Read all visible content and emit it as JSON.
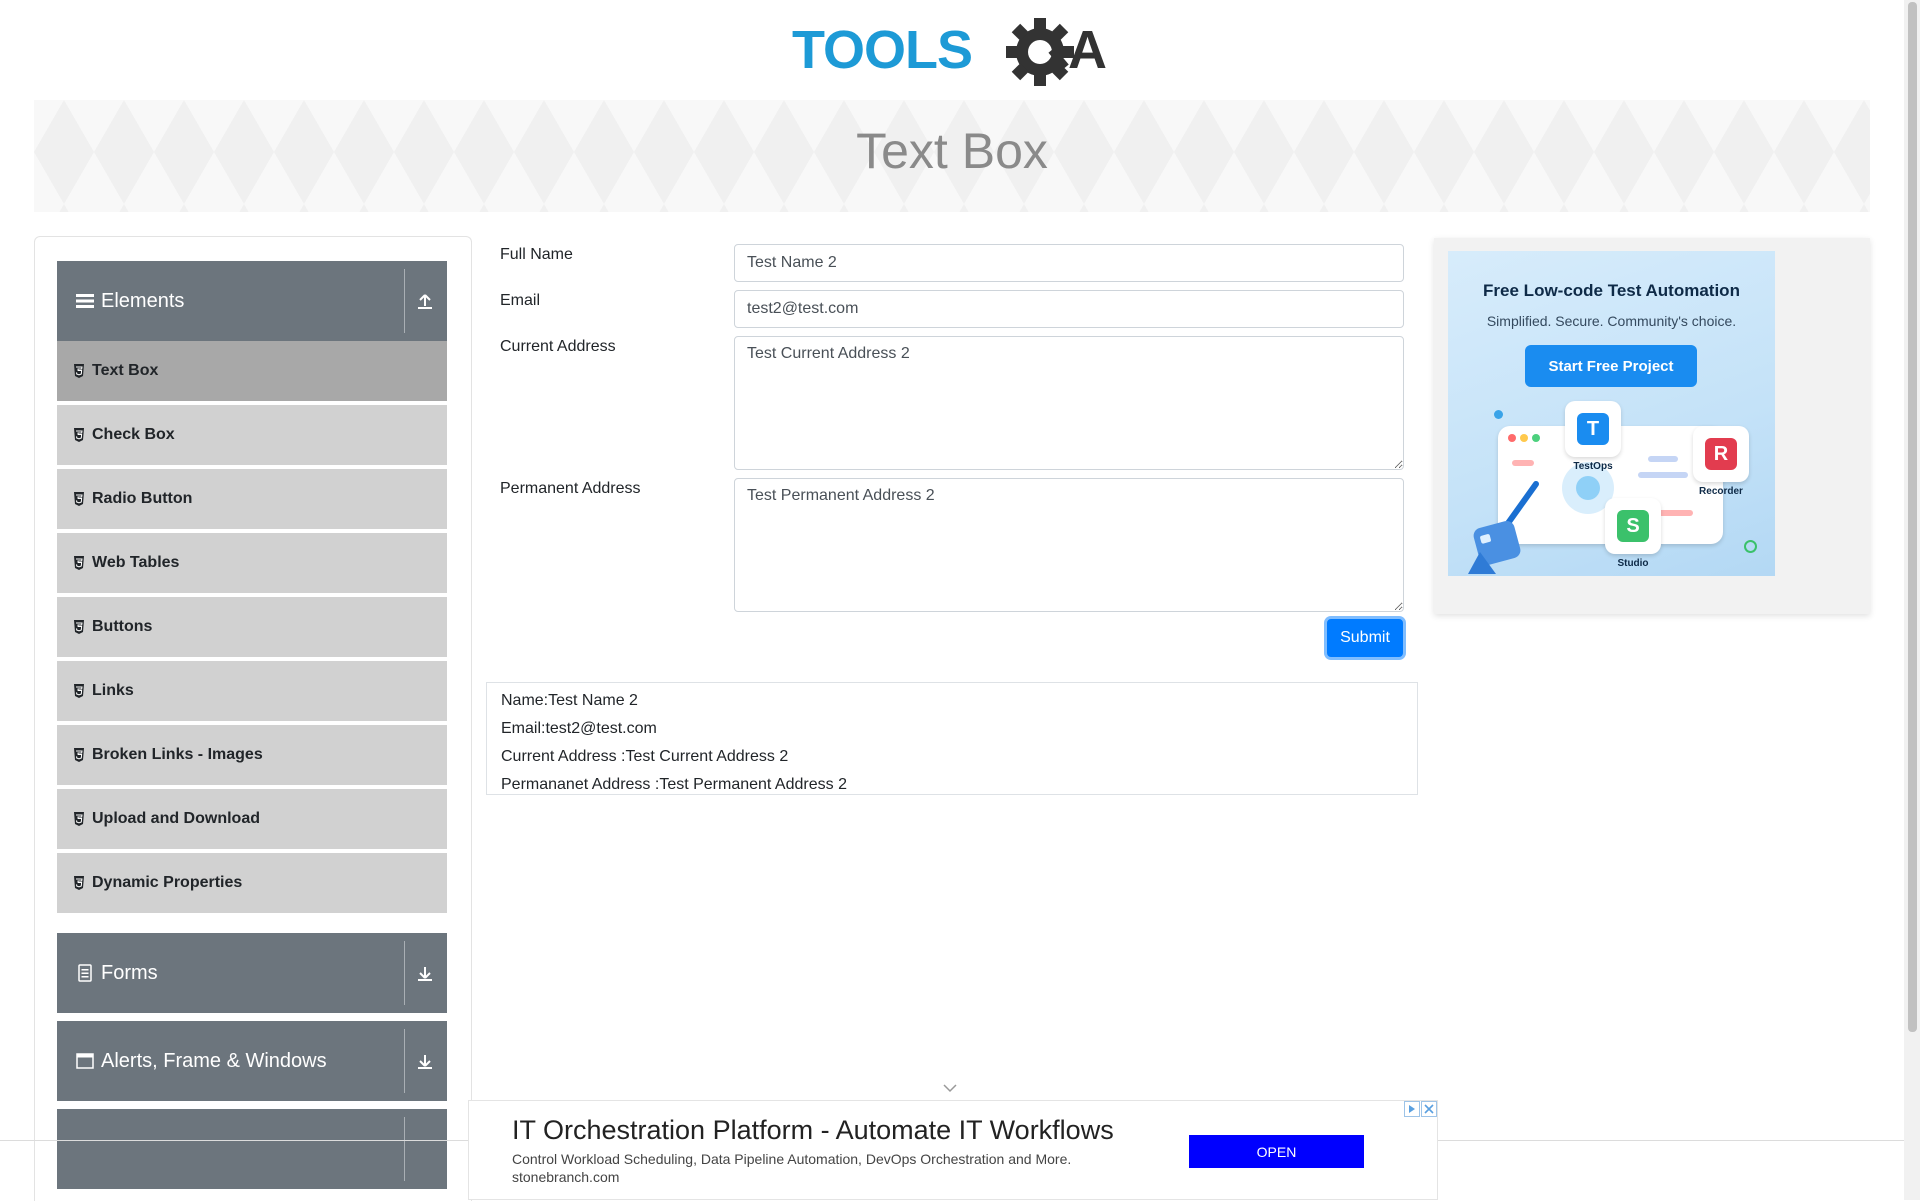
{
  "header": {
    "logo_text_left": "TOOLS",
    "logo_text_right": "A"
  },
  "banner": {
    "title": "Text Box"
  },
  "sidebar": {
    "groups": [
      {
        "title": "Elements",
        "icon": "menu-icon",
        "expanded": true,
        "items": [
          {
            "label": "Text Box",
            "active": true
          },
          {
            "label": "Check Box"
          },
          {
            "label": "Radio Button"
          },
          {
            "label": "Web Tables"
          },
          {
            "label": "Buttons"
          },
          {
            "label": "Links"
          },
          {
            "label": "Broken Links - Images"
          },
          {
            "label": "Upload and Download"
          },
          {
            "label": "Dynamic Properties"
          }
        ]
      },
      {
        "title": "Forms",
        "icon": "form-icon",
        "expanded": false
      },
      {
        "title": "Alerts, Frame & Windows",
        "icon": "window-icon",
        "expanded": false
      }
    ]
  },
  "form": {
    "full_name_label": "Full Name",
    "full_name_value": "Test Name 2",
    "email_label": "Email",
    "email_value": "test2@test.com",
    "current_address_label": "Current Address",
    "current_address_value": "Test Current Address 2",
    "permanent_address_label": "Permanent Address",
    "permanent_address_value": "Test Permanent Address 2",
    "submit_label": "Submit"
  },
  "output": {
    "name": "Name:Test Name 2",
    "email": "Email:test2@test.com",
    "current_address": "Current Address :Test Current Address 2",
    "permanent_address": "Permananet Address :Test Permanent Address 2"
  },
  "ad_side": {
    "title": "Free Low-code Test Automation",
    "subtitle": "Simplified. Secure. Community's choice.",
    "button": "Start Free Project",
    "apps": [
      "TestOps",
      "Recorder",
      "Studio"
    ]
  },
  "ad_bottom": {
    "title": "IT Orchestration Platform - Automate IT Workflows",
    "description": "Control Workload Scheduling, Data Pipeline Automation, DevOps Orchestration and More.",
    "domain": "stonebranch.com",
    "button": "OPEN"
  },
  "colors": {
    "accent": "#007bff",
    "sidebar_header": "#6c757d",
    "menu_item": "#d1d1d1",
    "menu_item_active": "#a8a8a8",
    "logo_blue": "#1d9ad6",
    "logo_dark": "#333333"
  }
}
